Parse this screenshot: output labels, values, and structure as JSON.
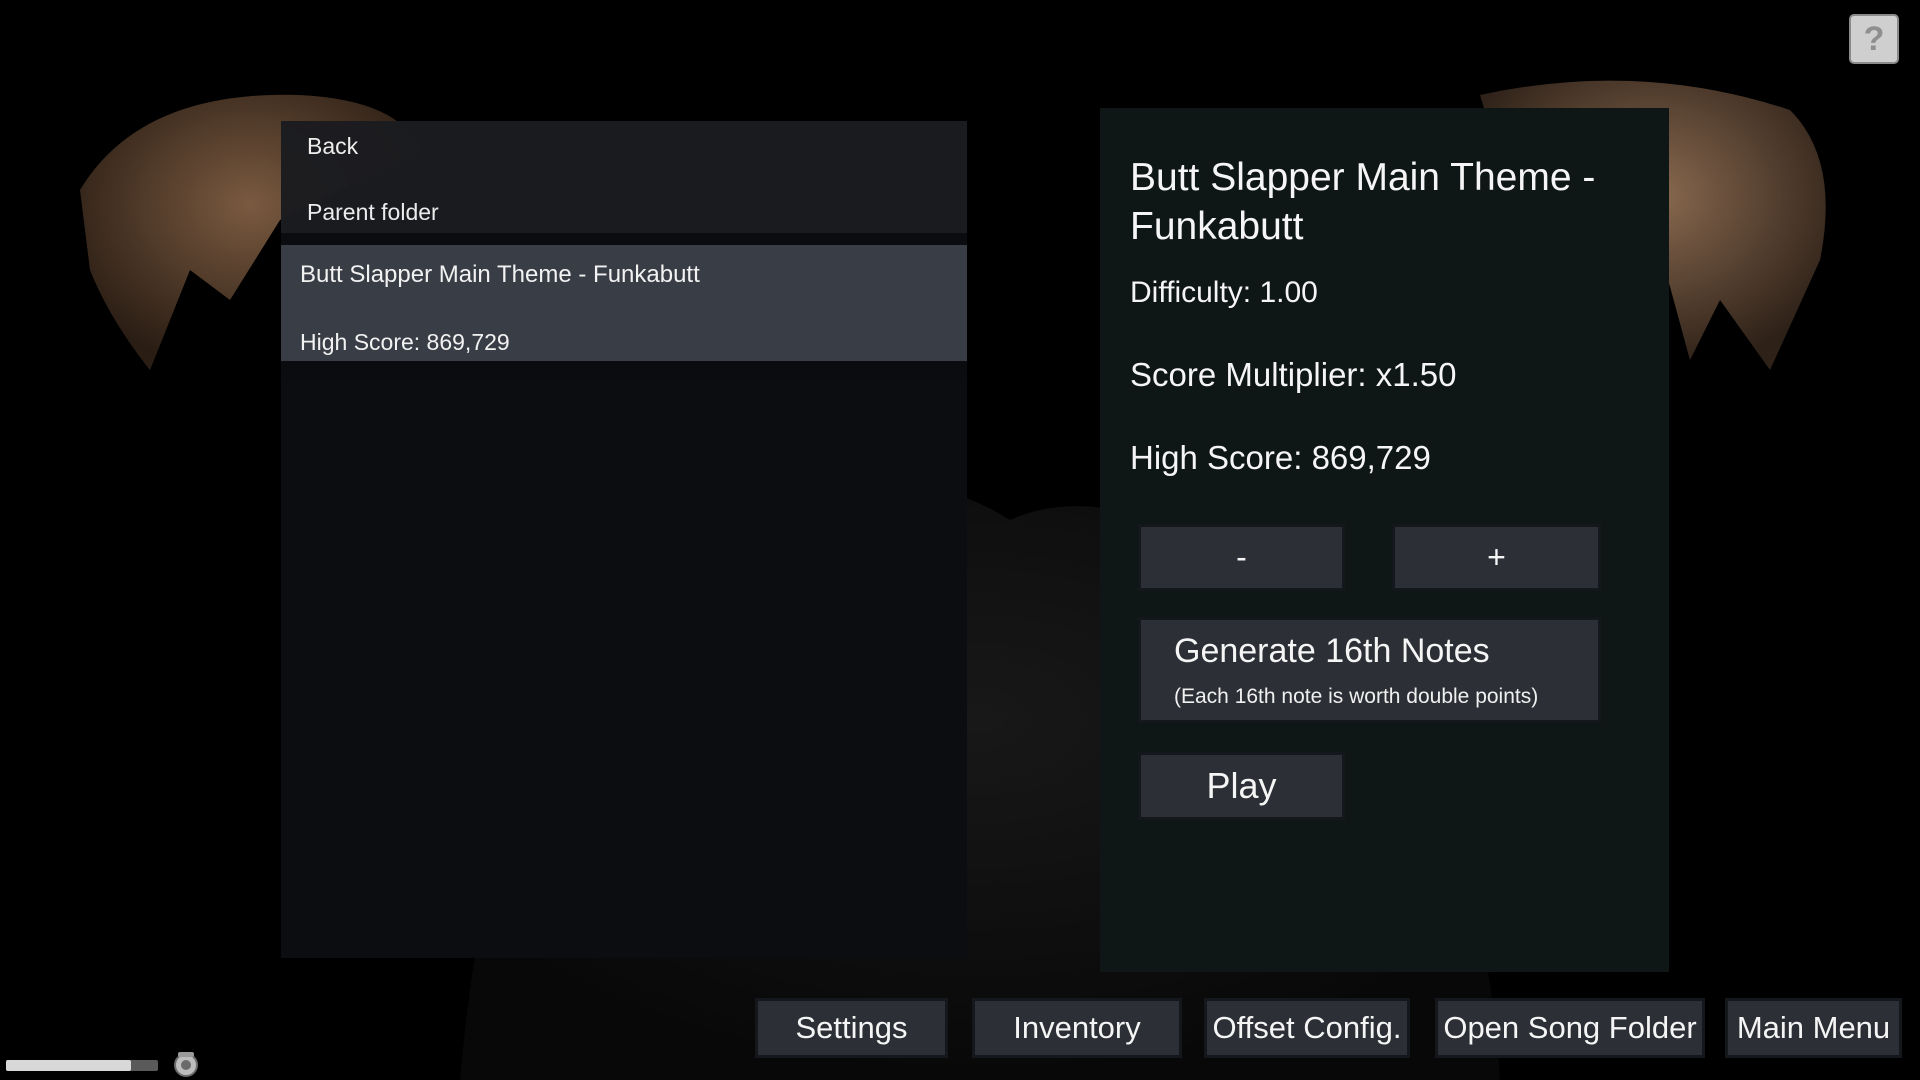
{
  "song_list": {
    "back_label": "Back",
    "parent_folder_label": "Parent folder",
    "songs": [
      {
        "title": "Butt Slapper Main Theme - Funkabutt",
        "high_score": "High Score: 869,729",
        "selected": true
      }
    ]
  },
  "details": {
    "title": "Butt Slapper Main Theme - Funkabutt",
    "difficulty": "Difficulty: 1.00",
    "score_multiplier": "Score Multiplier: x1.50",
    "high_score": "High Score: 869,729",
    "decrease_label": "-",
    "increase_label": "+",
    "generate_title": "Generate 16th Notes",
    "generate_subtitle": "(Each 16th note is worth double points)",
    "play_label": "Play"
  },
  "bottom_bar": {
    "buttons": [
      "Settings",
      "Inventory",
      "Offset Config.",
      "Open Song Folder",
      "Main Menu"
    ]
  },
  "help_label": "?",
  "volume": {
    "level": 0.82,
    "icon": "speaker-icon"
  },
  "colors": {
    "background": "#000000",
    "list_panel": "#0c0d11",
    "selected_row": "#3b3f49",
    "detail_panel": "#0e1616",
    "button": "#2c2f35",
    "text": "#f5f5f5"
  }
}
